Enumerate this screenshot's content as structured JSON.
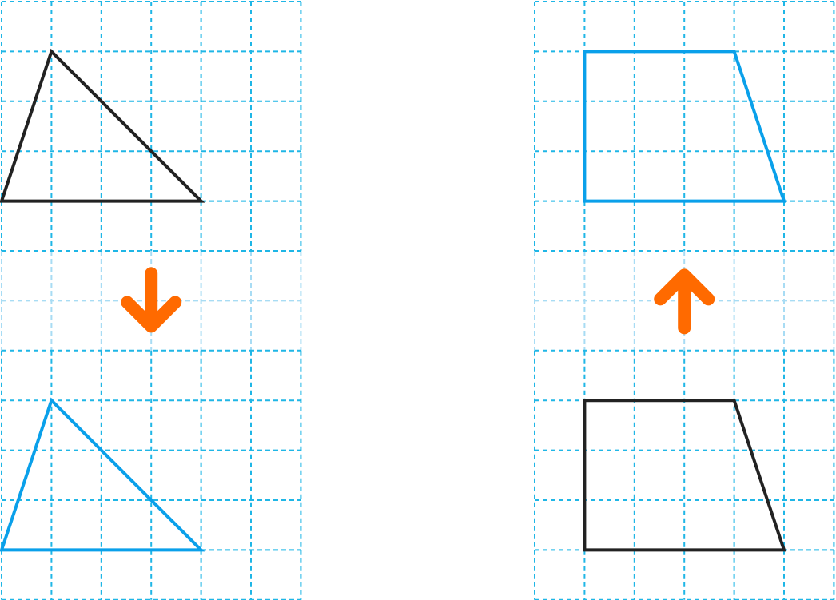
{
  "colors": {
    "grid_line": "#1fb6e6",
    "grid_line_faded": "#a8dcf4",
    "original_shape": "#222222",
    "translated_shape": "#0aa0ea",
    "arrow": "#ff6a00",
    "background": "#ffffff"
  },
  "panels": [
    {
      "id": "left",
      "grid_cols": 6,
      "grid_rows": 12,
      "faded_band_rows": [
        5,
        6
      ],
      "arrow": {
        "direction": "down",
        "icon": "arrow-down-icon"
      },
      "shapes": [
        {
          "id": "triangle-original",
          "role": "original",
          "kind": "triangle",
          "vertices": [
            [
              1,
              1
            ],
            [
              0,
              4
            ],
            [
              4,
              4
            ]
          ]
        },
        {
          "id": "triangle-translated",
          "role": "translated",
          "kind": "triangle",
          "vertices": [
            [
              1,
              8
            ],
            [
              0,
              11
            ],
            [
              4,
              11
            ]
          ]
        }
      ]
    },
    {
      "id": "right",
      "grid_cols": 6,
      "grid_rows": 12,
      "faded_band_rows": [
        5,
        6
      ],
      "arrow": {
        "direction": "up",
        "icon": "arrow-up-icon"
      },
      "shapes": [
        {
          "id": "trapezoid-translated",
          "role": "translated",
          "kind": "trapezoid",
          "vertices": [
            [
              1,
              1
            ],
            [
              4,
              1
            ],
            [
              5,
              4
            ],
            [
              1,
              4
            ]
          ]
        },
        {
          "id": "trapezoid-original",
          "role": "original",
          "kind": "trapezoid",
          "vertices": [
            [
              1,
              8
            ],
            [
              4,
              8
            ],
            [
              5,
              11
            ],
            [
              1,
              11
            ]
          ]
        }
      ]
    }
  ]
}
